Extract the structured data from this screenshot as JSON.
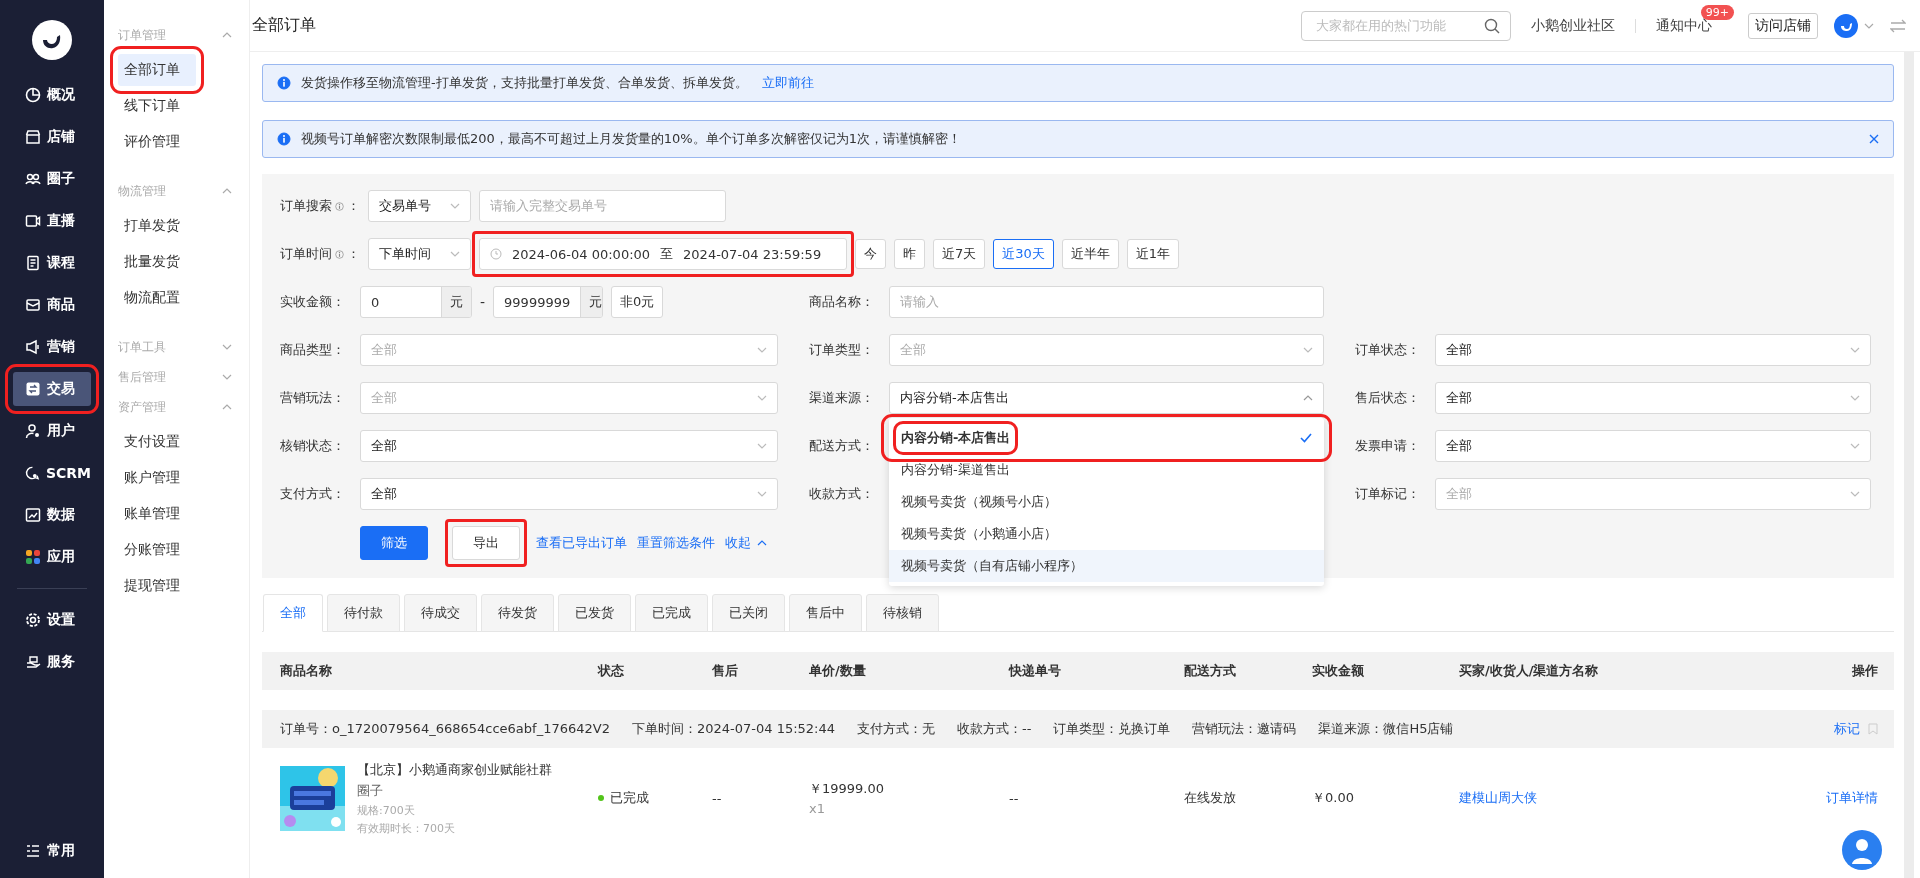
{
  "nav": {
    "items": [
      {
        "label": "概况",
        "selected": false,
        "highlighted": false
      },
      {
        "label": "店铺",
        "selected": false,
        "highlighted": false
      },
      {
        "label": "圈子",
        "selected": false,
        "highlighted": false
      },
      {
        "label": "直播",
        "selected": false,
        "highlighted": false
      },
      {
        "label": "课程",
        "selected": false,
        "highlighted": false
      },
      {
        "label": "商品",
        "selected": false,
        "highlighted": false
      },
      {
        "label": "营销",
        "selected": false,
        "highlighted": false
      },
      {
        "label": "交易",
        "selected": true,
        "highlighted": true
      },
      {
        "label": "用户",
        "selected": false,
        "highlighted": false
      },
      {
        "label": "SCRM",
        "selected": false,
        "highlighted": false
      },
      {
        "label": "数据",
        "selected": false,
        "highlighted": false
      },
      {
        "label": "应用",
        "selected": false,
        "highlighted": false
      }
    ],
    "extra_items": [
      {
        "label": "设置",
        "selected": false,
        "highlighted": false
      },
      {
        "label": "服务",
        "selected": false,
        "highlighted": false
      }
    ],
    "footer": "常用"
  },
  "subnav": {
    "groups": [
      {
        "title": "订单管理",
        "expanded": true,
        "items": [
          {
            "label": "全部订单",
            "selected": true,
            "highlighted": true
          },
          {
            "label": "线下订单",
            "selected": false,
            "highlighted": false
          },
          {
            "label": "评价管理",
            "selected": false,
            "highlighted": false
          }
        ]
      },
      {
        "title": "物流管理",
        "expanded": true,
        "items": [
          {
            "label": "打单发货",
            "selected": false,
            "highlighted": false
          },
          {
            "label": "批量发货",
            "selected": false,
            "highlighted": false
          },
          {
            "label": "物流配置",
            "selected": false,
            "highlighted": false
          }
        ]
      },
      {
        "title": "订单工具",
        "expanded": false
      },
      {
        "title": "售后管理",
        "expanded": false
      },
      {
        "title": "资产管理",
        "expanded": true,
        "items": [
          {
            "label": "支付设置",
            "selected": false,
            "highlighted": false
          },
          {
            "label": "账户管理",
            "selected": false,
            "highlighted": false
          },
          {
            "label": "账单管理",
            "selected": false,
            "highlighted": false
          },
          {
            "label": "分账管理",
            "selected": false,
            "highlighted": false
          },
          {
            "label": "提现管理",
            "selected": false,
            "highlighted": false
          }
        ]
      }
    ]
  },
  "topbar": {
    "title": "全部订单",
    "search_placeholder": "大家都在用的热门功能",
    "community": "小鹅创业社区",
    "notice": "通知中心",
    "notice_badge": "99+",
    "visit": "访问店铺"
  },
  "alerts": [
    {
      "text": "发货操作移至物流管理-打单发货，支持批量打单发货、合单发货、拆单发货。",
      "link": "立即前往",
      "closable": false
    },
    {
      "text": "视频号订单解密次数限制最低200，最高不可超过上月发货量的10%。单个订单多次解密仅记为1次，请谨慎解密！",
      "closable": true
    }
  ],
  "filters": {
    "search": {
      "label": "订单搜索",
      "label_suffix": "：",
      "type": "交易单号",
      "placeholder": "请输入完整交易单号"
    },
    "time": {
      "label": "订单时间",
      "label_suffix": "：",
      "type": "下单时间",
      "start": "2024-06-04 00:00:00",
      "separator": "至",
      "end": "2024-07-04 23:59:59",
      "highlighted": true,
      "quick": [
        {
          "label": "今",
          "selected": false
        },
        {
          "label": "昨",
          "selected": false
        },
        {
          "label": "近7天",
          "selected": false
        },
        {
          "label": "近30天",
          "selected": true
        },
        {
          "label": "近半年",
          "selected": false
        },
        {
          "label": "近1年",
          "selected": false
        }
      ]
    },
    "grid_rows": [
      [
        {
          "kind": "amount",
          "label": "实收金额：",
          "min": "0",
          "min_unit": "元",
          "dash": "-",
          "max": "99999999",
          "max_unit": "元",
          "nonzero": "非0元"
        },
        {
          "kind": "input",
          "label": "商品名称：",
          "placeholder": "请输入"
        }
      ],
      [
        {
          "kind": "select",
          "label": "商品类型：",
          "placeholder": "全部"
        },
        {
          "kind": "select",
          "label": "订单类型：",
          "placeholder": "全部"
        },
        {
          "kind": "select",
          "label": "订单状态：",
          "value": "全部"
        }
      ],
      [
        {
          "kind": "select",
          "label": "营销玩法：",
          "placeholder": "全部"
        },
        {
          "kind": "select",
          "label": "渠道来源：",
          "value": "内容分销-本店售出",
          "open": true,
          "options": [
            {
              "label": "内容分销-本店售出",
              "selected": true,
              "hovered": false,
              "highlighted": true
            },
            {
              "label": "内容分销-渠道售出",
              "selected": false,
              "hovered": false,
              "highlighted": false
            },
            {
              "label": "视频号卖货（视频号小店）",
              "selected": false,
              "hovered": false,
              "highlighted": false
            },
            {
              "label": "视频号卖货（小鹅通小店）",
              "selected": false,
              "hovered": false,
              "highlighted": false
            },
            {
              "label": "视频号卖货（自有店铺小程序）",
              "selected": false,
              "hovered": true,
              "highlighted": false
            }
          ]
        },
        {
          "kind": "select",
          "label": "售后状态：",
          "value": "全部"
        }
      ],
      [
        {
          "kind": "select",
          "label": "核销状态：",
          "value": "全部"
        },
        {
          "kind": "covered",
          "label": "配送方式："
        },
        {
          "kind": "select",
          "label": "发票申请：",
          "value": "全部"
        }
      ],
      [
        {
          "kind": "select",
          "label": "支付方式：",
          "value": "全部"
        },
        {
          "kind": "covered",
          "label": "收款方式："
        },
        {
          "kind": "select",
          "label": "订单标记：",
          "placeholder": "全部"
        }
      ]
    ],
    "actions": [
      {
        "kind": "primary",
        "label": "筛选",
        "highlighted": false
      },
      {
        "kind": "default",
        "label": "导出",
        "highlighted": true
      },
      {
        "kind": "link",
        "label": "查看已导出订单"
      },
      {
        "kind": "link",
        "label": "重置筛选条件"
      },
      {
        "kind": "toggle",
        "label": "收起",
        "expanded": true
      }
    ]
  },
  "tabs": [
    {
      "label": "全部",
      "selected": true
    },
    {
      "label": "待付款",
      "selected": false
    },
    {
      "label": "待成交",
      "selected": false
    },
    {
      "label": "待发货",
      "selected": false
    },
    {
      "label": "已发货",
      "selected": false
    },
    {
      "label": "已完成",
      "selected": false
    },
    {
      "label": "已关闭",
      "selected": false
    },
    {
      "label": "售后中",
      "selected": false
    },
    {
      "label": "待核销",
      "selected": false
    }
  ],
  "table": {
    "columns": [
      "商品名称",
      "状态",
      "售后",
      "单价/数量",
      "快递单号",
      "配送方式",
      "实收金额",
      "买家/收货人/渠道方名称",
      "操作"
    ],
    "orders": [
      {
        "meta": [
          "订单号：o_1720079564_668654cce6abf_176642V2",
          "下单时间：2024-07-04 15:52:44",
          "支付方式：无",
          "收款方式：--",
          "订单类型：兑换订单",
          "营销玩法：邀请码",
          "渠道来源：微信H5店铺"
        ],
        "mark": "标记",
        "items": [
          {
            "name": "【北京】小鹅通商家创业赋能社群",
            "type": "圈子",
            "spec": "规格:700天",
            "validity": "有效期时长：700天",
            "status": "已完成",
            "color": "#52c41a",
            "after_sale": "--",
            "price": "￥19999.00",
            "qty": "x1",
            "tracking": "--",
            "delivery": "在线发放",
            "paid": "￥0.00",
            "buyer": "建模山周大侠",
            "action": "订单详情"
          }
        ]
      }
    ]
  }
}
